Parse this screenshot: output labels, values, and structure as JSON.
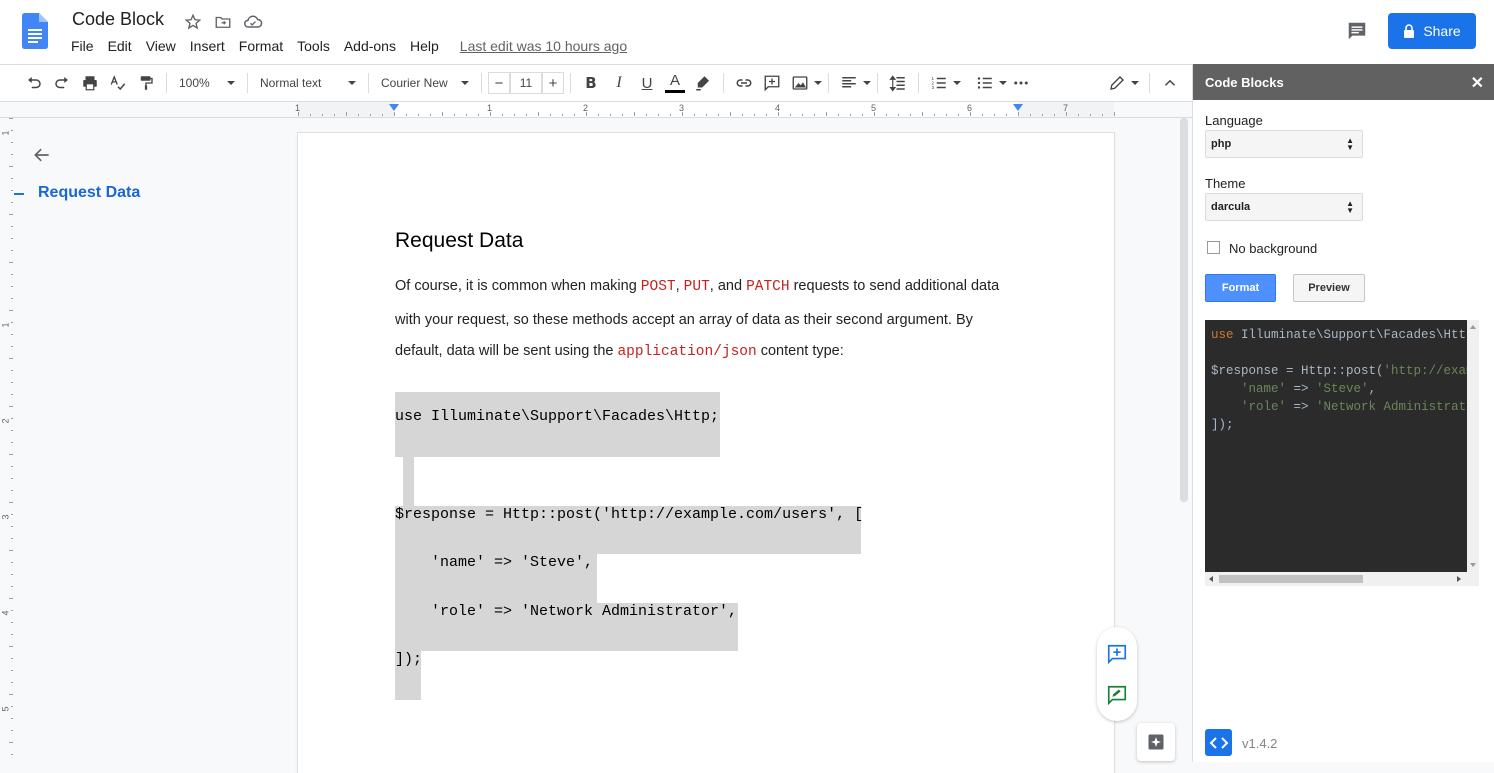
{
  "header": {
    "doc_title": "Code Block",
    "menus": [
      "File",
      "Edit",
      "View",
      "Insert",
      "Format",
      "Tools",
      "Add-ons",
      "Help"
    ],
    "last_edit": "Last edit was 10 hours ago",
    "share_label": "Share"
  },
  "toolbar": {
    "zoom": "100%",
    "style": "Normal text",
    "font": "Courier New",
    "font_size": "11",
    "minus": "−",
    "plus": "+",
    "bold": "B",
    "italic": "I",
    "underline": "U",
    "text_color": "A"
  },
  "ruler": {
    "numbers": [
      "1",
      "1",
      "2",
      "3",
      "4",
      "5",
      "6",
      "7"
    ],
    "vertical_numbers": [
      "1",
      "1",
      "2",
      "3",
      "4",
      "5"
    ]
  },
  "outline": {
    "item": "Request Data"
  },
  "document": {
    "heading": "Request Data",
    "para1": {
      "t1": "Of course, it is common when making ",
      "post": "POST",
      "t2": ", ",
      "put": "PUT",
      "t3": ", and ",
      "patch": "PATCH",
      "t4": " requests to send additional data"
    },
    "para2": "with your request, so these methods accept an array of data as their second argument. By",
    "para3": {
      "t1": "default, data will be sent using the ",
      "mime": "application/json",
      "t2": " content type:"
    },
    "code_lines": [
      "use Illuminate\\Support\\Facades\\Http;",
      "",
      "$response = Http::post('http://example.com/users', [",
      "    'name' => 'Steve',",
      "    'role' => 'Network Administrator',",
      "]);"
    ]
  },
  "panel": {
    "title": "Code Blocks",
    "close": "✕",
    "language_label": "Language",
    "language_value": "php",
    "theme_label": "Theme",
    "theme_value": "darcula",
    "no_background_label": "No background",
    "format_label": "Format",
    "preview_label": "Preview",
    "preview": {
      "l1_kw": "use",
      "l1_rest": " Illuminate\\Support\\Facades\\Http;",
      "l3_a": "$response = Http::post(",
      "l3_str": "'http://example.com/users'",
      "l3_b": ", [",
      "l4_str1": "'name'",
      "l4_mid": " => ",
      "l4_str2": "'Steve'",
      "l4_end": ",",
      "l5_str1": "'role'",
      "l5_mid": " => ",
      "l5_str2": "'Network Administrator'",
      "l5_end": ",",
      "l6": "]);"
    },
    "version": "v1.4.2"
  },
  "colors": {
    "accent": "#1a73e8",
    "panel_header": "#616161",
    "code_bg": "#2b2b2b",
    "inline_code": "#c5221f"
  },
  "icons": [
    "docs-logo-icon",
    "star-icon",
    "move-folder-icon",
    "cloud-saved-icon",
    "comment-icon",
    "lock-icon",
    "undo-icon",
    "redo-icon",
    "print-icon",
    "spellcheck-icon",
    "paint-format-icon",
    "highlight-icon",
    "link-icon",
    "add-comment-icon",
    "image-icon",
    "align-icon",
    "line-spacing-icon",
    "numbered-list-icon",
    "bulleted-list-icon",
    "more-icon",
    "edit-mode-icon",
    "collapse-icon",
    "back-arrow-icon",
    "suggest-edit-icon",
    "explore-icon",
    "code-icon"
  ]
}
